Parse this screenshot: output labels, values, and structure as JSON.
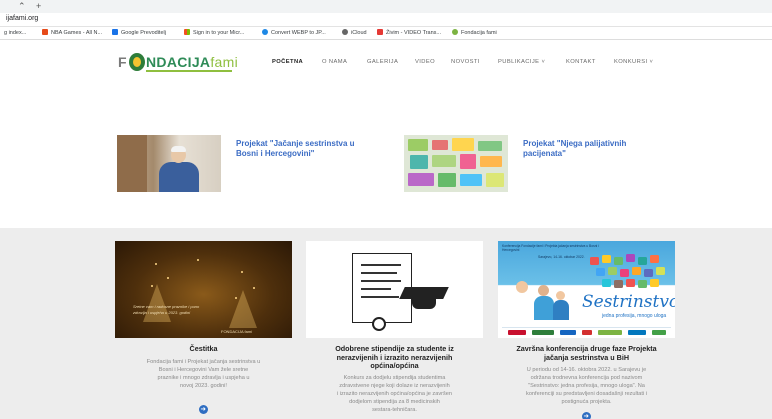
{
  "browser": {
    "tab_controls": [
      "⌃",
      "+"
    ],
    "url": "ijafami.org",
    "bookmarks": [
      {
        "label": "g index...",
        "color": "#9e9e9e"
      },
      {
        "label": "NBA Games - All N...",
        "color": "#e64a19"
      },
      {
        "label": "Google Prevoditelj",
        "color": "#1a73e8"
      },
      {
        "label": "Sign in to your Micr...",
        "color": "#f25022"
      },
      {
        "label": "Convert WEBP to JP...",
        "color": "#1e88e5"
      },
      {
        "label": "iCloud",
        "color": "#666666"
      },
      {
        "label": "Živim - VIDEO Trans...",
        "color": "#e53935"
      },
      {
        "label": "Fondacija fami",
        "color": "#7cb342"
      }
    ]
  },
  "site": {
    "logo": {
      "left": "F",
      "name_main": "NDACIJA",
      "name_lite": "fami"
    },
    "nav": [
      {
        "label": "POČETNA",
        "active": true
      },
      {
        "label": "O NAMA",
        "active": false
      },
      {
        "label": "GALERIJA",
        "active": false
      },
      {
        "label": "VIDEO",
        "active": false
      },
      {
        "label": "NOVOSTI",
        "active": false
      },
      {
        "label": "PUBLIKACIJE ˅",
        "active": false
      },
      {
        "label": "KONTAKT",
        "active": false
      },
      {
        "label": "KONKURSI ˅",
        "active": false
      }
    ]
  },
  "projects": [
    {
      "title_line1": "Projekat \"Jačanje sestrinstva u",
      "title_line2": "Bosni i Hercegovini\""
    },
    {
      "title_line1": "Projekat \"Njega palijativnih",
      "title_line2": "pacijenata\""
    }
  ],
  "cards": [
    {
      "title": "Čestitka",
      "title_lines": [
        "Čestitka"
      ],
      "desc_lines": [
        "Fondacija fami i Projekat jačanja sestrinstva u",
        "Bosni i Hercegovini Vam žele sretne",
        "praznike i mnogo zdravlja i uspjeha u",
        "novoj 2023. godini!"
      ],
      "image_text": "Sretne vam i radosne praznike i puno zdravlja i uspjeha u 2023. godini",
      "image_footer": "FONDACIJA fami"
    },
    {
      "title": "Odobrene stipendije za studente iz nerazvijenih i izrazito nerazvijenih općina/općina",
      "title_lines": [
        "Odobrene stipendije za studente iz",
        "nerazvijenih i izrazito nerazvijenih",
        "općina/općina"
      ],
      "desc_lines": [
        "Konkurs za dodjelu stipendija studentima",
        "zdravstvene njege koji dolaze iz nerazvijenih",
        "i izrazito nerazvijenih općina/općina je završen",
        "dodjelom stipendija za 8 medicinskih",
        "sestara-tehničara."
      ]
    },
    {
      "title": "Završna konferencija druge faze Projekta jačanja sestrinstva u BiH",
      "title_lines": [
        "Završna konferencija druge faze Projekta",
        "jačanja sestrinstva u BiH"
      ],
      "desc_lines": [
        "U periodu od 14-16. oktobra 2022. u Sarajevu je",
        "održana trodnevna konferencija pod nazivom",
        "\"Sestrinstvo: jedna profesija, mnogo uloga\". Na",
        "konferenciji su predstavljeni dosadašnji rezultati i",
        "postignuća projekta."
      ],
      "poster_header": "Konferencija Fondacije fami i Projekta jačanja sestrinstva u Bosni i Hercegovini",
      "poster_date": "Sarajevo, 14-16. oktobar 2022.",
      "poster_title": "Sestrinstvo",
      "poster_subtitle": "jedna profesija, mnogo uloga"
    }
  ],
  "colors": {
    "link_blue": "#3b6cc4",
    "logo_green": "#2e8b57",
    "section_gray": "#ededed",
    "button_blue": "#2f6ec2"
  }
}
